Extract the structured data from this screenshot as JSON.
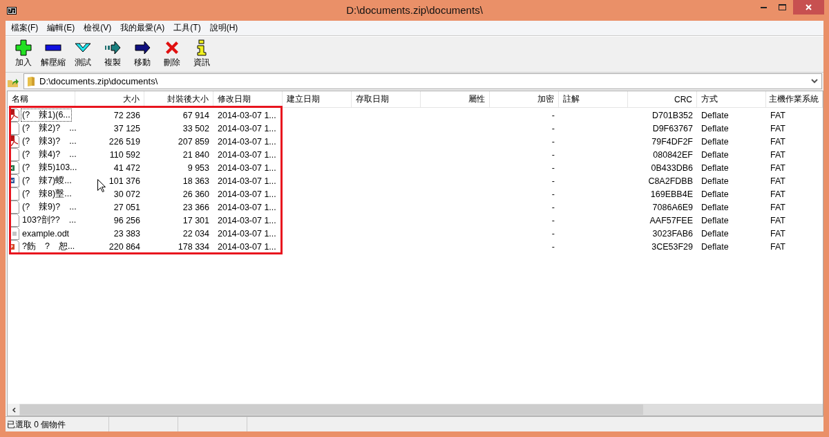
{
  "window": {
    "title": "D:\\documents.zip\\documents\\"
  },
  "menu": [
    "檔案(F)",
    "編輯(E)",
    "檢視(V)",
    "我的最愛(A)",
    "工具(T)",
    "說明(H)"
  ],
  "toolbar": [
    "加入",
    "解壓縮",
    "測試",
    "複製",
    "移動",
    "刪除",
    "資訊"
  ],
  "address": {
    "value": "D:\\documents.zip\\documents\\"
  },
  "table": {
    "columns": [
      {
        "label": "名稱"
      },
      {
        "label": "大小"
      },
      {
        "label": "封裝後大小"
      },
      {
        "label": "修改日期"
      },
      {
        "label": "建立日期"
      },
      {
        "label": "存取日期"
      },
      {
        "label": "屬性"
      },
      {
        "label": "加密"
      },
      {
        "label": "註解"
      },
      {
        "label": "CRC"
      },
      {
        "label": "方式"
      },
      {
        "label": "主機作業系統"
      }
    ],
    "rows": [
      {
        "kind": "pdf",
        "focused": true,
        "name": "(?　辣1)(6...",
        "size": "72 236",
        "packed": "67 914",
        "modified": "2014-03-07 1...",
        "encrypted": "-",
        "crc": "D701B352",
        "method": "Deflate",
        "host": "FAT"
      },
      {
        "kind": "blank",
        "focused": false,
        "name": "(?　辣2)?　...",
        "size": "37 125",
        "packed": "33 502",
        "modified": "2014-03-07 1...",
        "encrypted": "-",
        "crc": "D9F63767",
        "method": "Deflate",
        "host": "FAT"
      },
      {
        "kind": "pdf",
        "focused": false,
        "name": "(?　辣3)?　...",
        "size": "226 519",
        "packed": "207 859",
        "modified": "2014-03-07 1...",
        "encrypted": "-",
        "crc": "79F4DF2F",
        "method": "Deflate",
        "host": "FAT"
      },
      {
        "kind": "blank",
        "focused": false,
        "name": "(?　辣4)?　...",
        "size": "110 592",
        "packed": "21 840",
        "modified": "2014-03-07 1...",
        "encrypted": "-",
        "crc": "080842EF",
        "method": "Deflate",
        "host": "FAT"
      },
      {
        "kind": "sheet",
        "focused": false,
        "name": "(?　辣5)103...",
        "size": "41 472",
        "packed": "9 953",
        "modified": "2014-03-07 1...",
        "encrypted": "-",
        "crc": "0B433DB6",
        "method": "Deflate",
        "host": "FAT"
      },
      {
        "kind": "word",
        "focused": false,
        "name": "(?　辣7)蝬...",
        "size": "101 376",
        "packed": "18 363",
        "modified": "2014-03-07 1...",
        "encrypted": "-",
        "crc": "C8A2FDBB",
        "method": "Deflate",
        "host": "FAT"
      },
      {
        "kind": "blank",
        "focused": false,
        "name": "(?　辣8)墼...",
        "size": "30 072",
        "packed": "26 360",
        "modified": "2014-03-07 1...",
        "encrypted": "-",
        "crc": "169EBB4E",
        "method": "Deflate",
        "host": "FAT"
      },
      {
        "kind": "blank",
        "focused": false,
        "name": "(?　辣9)?　...",
        "size": "27 051",
        "packed": "23 366",
        "modified": "2014-03-07 1...",
        "encrypted": "-",
        "crc": "7086A6E9",
        "method": "Deflate",
        "host": "FAT"
      },
      {
        "kind": "blank",
        "focused": false,
        "name": "103?剖??　...",
        "size": "96 256",
        "packed": "17 301",
        "modified": "2014-03-07 1...",
        "encrypted": "-",
        "crc": "AAF57FEE",
        "method": "Deflate",
        "host": "FAT"
      },
      {
        "kind": "text",
        "focused": false,
        "name": "example.odt",
        "size": "23 383",
        "packed": "22 034",
        "modified": "2014-03-07 1...",
        "encrypted": "-",
        "crc": "3023FAB6",
        "method": "Deflate",
        "host": "FAT"
      },
      {
        "kind": "slides",
        "focused": false,
        "name": "?飭　?　恕...",
        "size": "220 864",
        "packed": "178 334",
        "modified": "2014-03-07 1...",
        "encrypted": "-",
        "crc": "3CE53F29",
        "method": "Deflate",
        "host": "FAT"
      }
    ]
  },
  "status_bar": {
    "text": "已選取 0 個物件"
  }
}
